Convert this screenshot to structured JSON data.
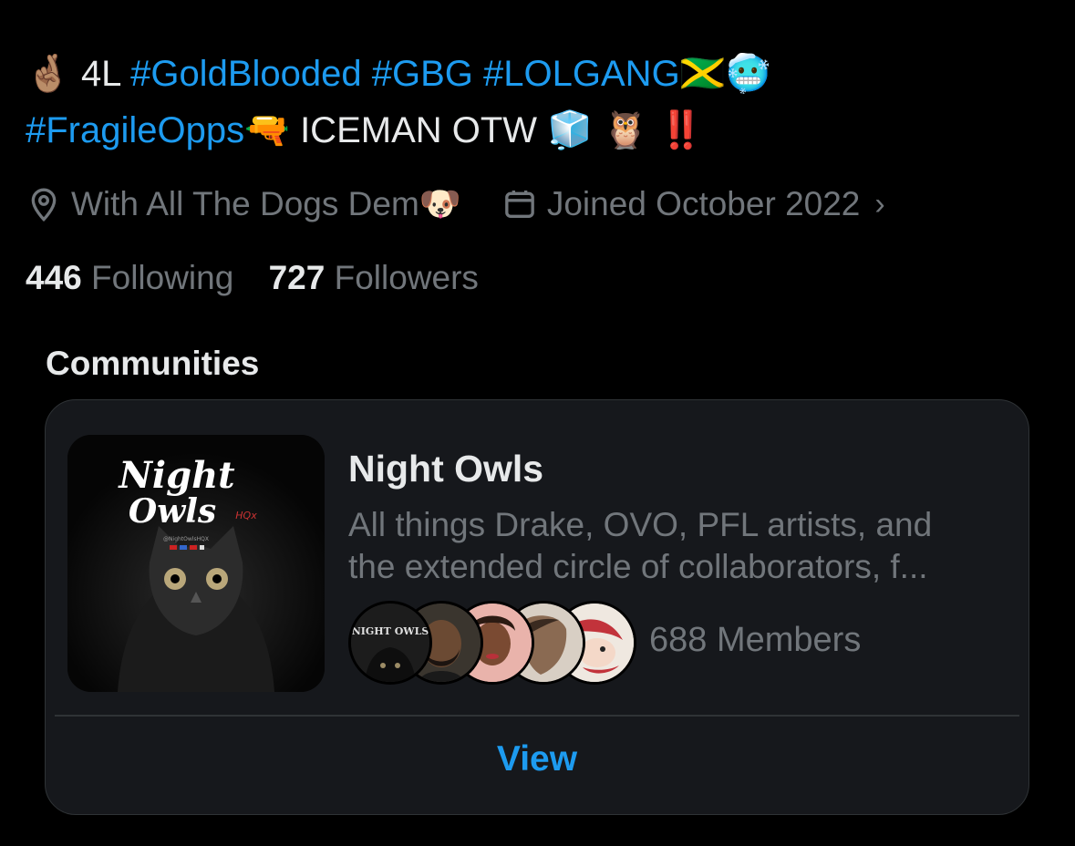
{
  "bio": {
    "line1": {
      "emoji_fingers": "🤞🏽",
      "text_4l": "4L",
      "tag1": "#GoldBlooded",
      "tag2": "#GBG",
      "tag3": "#LOLGANG",
      "emoji_flag": "🇯🇲",
      "emoji_cold": "🥶"
    },
    "line2": {
      "tag4": "#FragileOpps",
      "emoji_gun": "🔫",
      "text": "ICEMAN OTW",
      "emoji_ice": "🧊",
      "emoji_owl": "🦉",
      "emoji_alert": "‼️"
    }
  },
  "meta": {
    "location": "With All The Dogs Dem",
    "location_emoji": "🐶",
    "joined": "Joined October 2022",
    "chevron": "›"
  },
  "stats": {
    "following_count": "446",
    "following_label": "Following",
    "followers_count": "727",
    "followers_label": "Followers"
  },
  "communities": {
    "section_title": "Communities",
    "card": {
      "name": "Night Owls",
      "description": "All things Drake, OVO, PFL artists, and the extended circle of collaborators, f...",
      "members": "688 Members",
      "view_label": "View",
      "thumb_logo_line1": "Night",
      "thumb_logo_line2": "Owls",
      "thumb_logo_suffix": "HQx",
      "thumb_handle": "@NightOwlsHQX",
      "avatar_logo_text": "NIGHT OWLS"
    }
  },
  "colors": {
    "background": "#000000",
    "card": "#16181c",
    "border": "#2f3336",
    "text_primary": "#e7e9ea",
    "text_secondary": "#71767b",
    "accent": "#1d9bf0"
  },
  "icons": {
    "location": "map-pin-icon",
    "calendar": "calendar-icon",
    "chevron": "chevron-right-icon"
  }
}
